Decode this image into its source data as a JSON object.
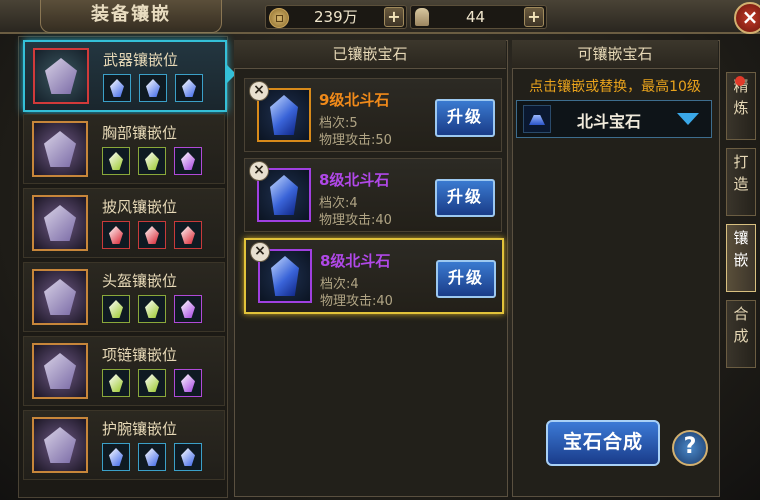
{
  "title": "装备镶嵌",
  "currency": {
    "coins": "239万",
    "people": "44"
  },
  "columns": {
    "inlaid": "已镶嵌宝石",
    "available": "可镶嵌宝石"
  },
  "slots": [
    {
      "name": "武器镶嵌位",
      "icon": "weapon-icon",
      "gems": [
        "blue",
        "blue",
        "blue"
      ],
      "active": true
    },
    {
      "name": "胸部镶嵌位",
      "icon": "chest-armor-icon",
      "gems": [
        "green",
        "green",
        "purple"
      ],
      "active": false
    },
    {
      "name": "披风镶嵌位",
      "icon": "cape-icon",
      "gems": [
        "red",
        "red",
        "red"
      ],
      "active": false
    },
    {
      "name": "头盔镶嵌位",
      "icon": "helmet-icon",
      "gems": [
        "green",
        "green",
        "purple"
      ],
      "active": false
    },
    {
      "name": "项链镶嵌位",
      "icon": "necklace-icon",
      "gems": [
        "green",
        "green",
        "purple"
      ],
      "active": false
    },
    {
      "name": "护腕镶嵌位",
      "icon": "bracer-icon",
      "gems": [
        "blue",
        "blue",
        "blue"
      ],
      "active": false
    }
  ],
  "inlaid_gems": [
    {
      "title": "9级北斗石",
      "grade": "档次:5",
      "attack": "物理攻击:50",
      "color": "orange",
      "upgrade": "升级"
    },
    {
      "title": "8级北斗石",
      "grade": "档次:4",
      "attack": "物理攻击:40",
      "color": "purple",
      "upgrade": "升级"
    },
    {
      "title": "8级北斗石",
      "grade": "档次:4",
      "attack": "物理攻击:40",
      "color": "purple",
      "upgrade": "升级"
    }
  ],
  "hint": "点击镶嵌或替换，最高10级",
  "selected_gem": "北斗宝石",
  "compose_label": "宝石合成",
  "help_label": "?",
  "side_tabs": [
    {
      "label": "精炼",
      "active": false
    },
    {
      "label": "打造",
      "active": false
    },
    {
      "label": "镶嵌",
      "active": true
    },
    {
      "label": "合成",
      "active": false
    }
  ],
  "gem_colors": {
    "blue": "#3a64e8",
    "green": "#9ac82a",
    "purple": "#a442e0",
    "red": "#d8202e"
  }
}
